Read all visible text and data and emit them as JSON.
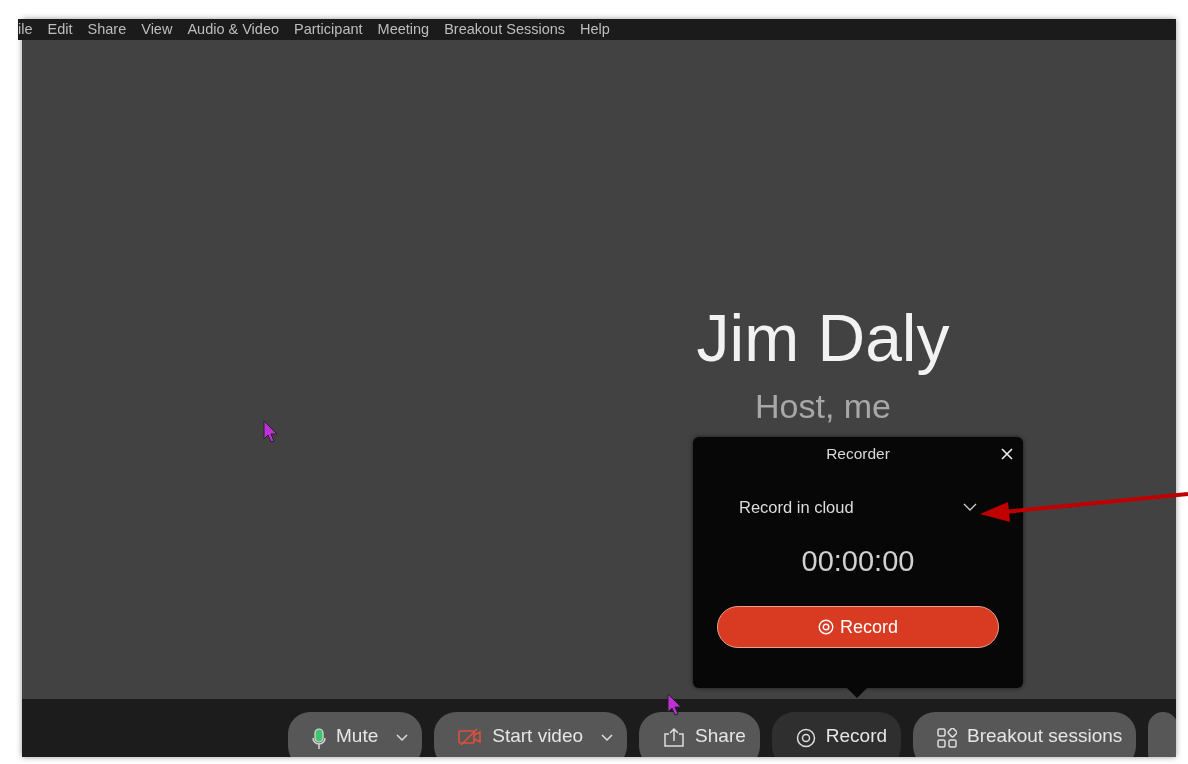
{
  "menu_bar": {
    "items": [
      {
        "label": "ile"
      },
      {
        "label": "Edit"
      },
      {
        "label": "Share"
      },
      {
        "label": "View"
      },
      {
        "label": "Audio & Video"
      },
      {
        "label": "Participant"
      },
      {
        "label": "Meeting"
      },
      {
        "label": "Breakout Sessions"
      },
      {
        "label": "Help"
      }
    ]
  },
  "participant": {
    "name": "Jim Daly",
    "role": "Host, me"
  },
  "recorder": {
    "title": "Recorder",
    "mode": "Record in cloud",
    "timer": "00:00:00",
    "record_button": "Record"
  },
  "toolbar": {
    "buttons": [
      {
        "label": "Mute",
        "kind": "mic",
        "has_menu": true,
        "selected": false
      },
      {
        "label": "Start video",
        "kind": "video",
        "has_menu": true,
        "selected": false
      },
      {
        "label": "Share",
        "kind": "share",
        "has_menu": false,
        "selected": false
      },
      {
        "label": "Record",
        "kind": "record",
        "has_menu": false,
        "selected": true
      },
      {
        "label": "Breakout sessions",
        "kind": "breakout",
        "has_menu": false,
        "selected": false
      }
    ]
  }
}
